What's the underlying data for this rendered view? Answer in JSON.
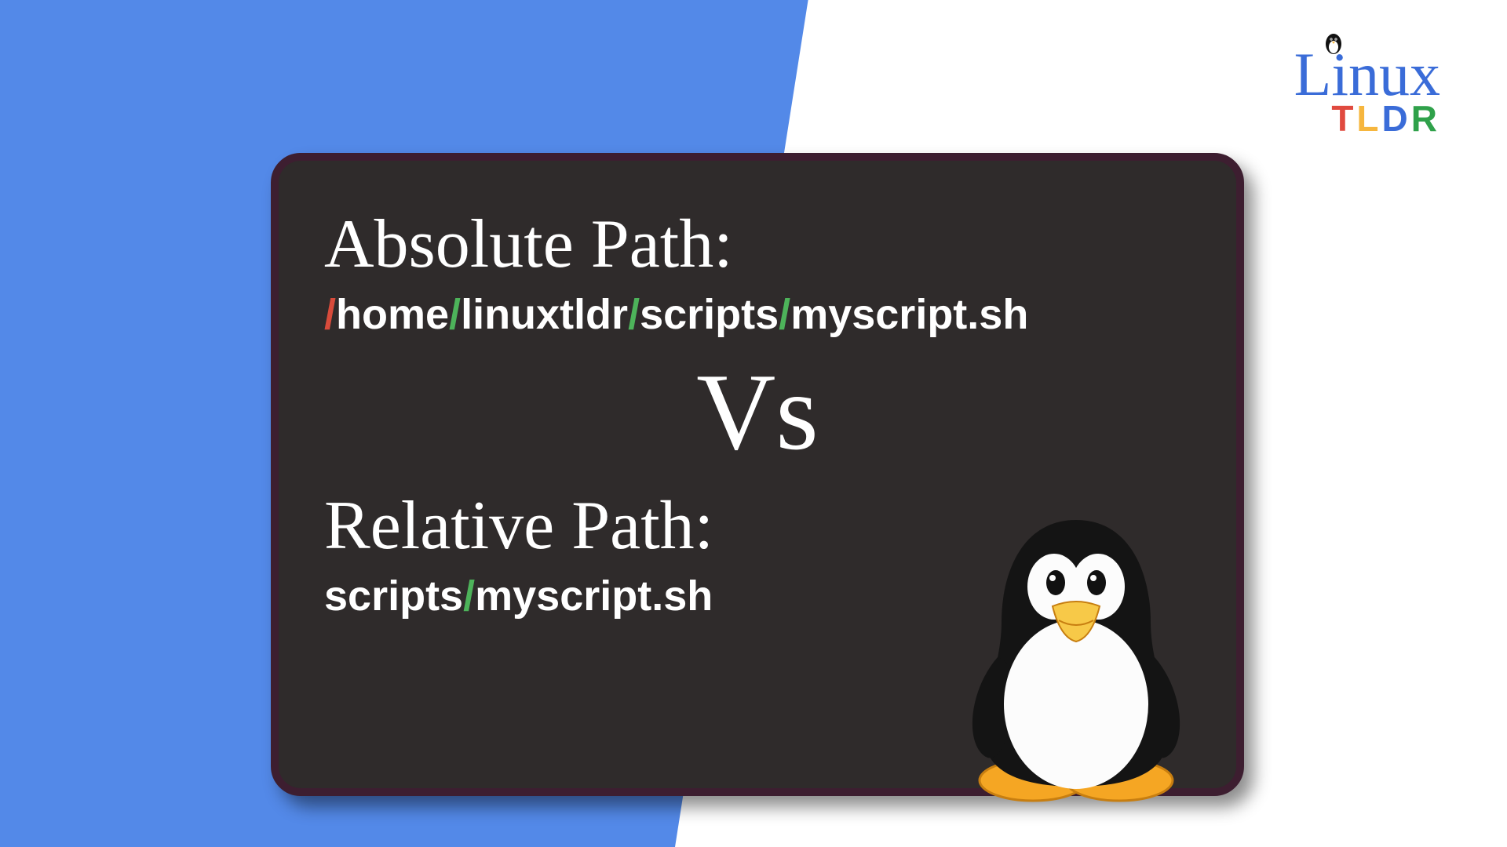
{
  "logo": {
    "text": "Linux",
    "tldr": {
      "t": "T",
      "l": "L",
      "d": "D",
      "r": "R"
    }
  },
  "chalkboard": {
    "absolute_heading": "Absolute Path:",
    "absolute_path": {
      "sep1": "/",
      "seg1": "home",
      "sep2": "/",
      "seg2": "linuxtldr",
      "sep3": "/",
      "seg3": "scripts",
      "sep4": "/",
      "seg4": "myscript.sh"
    },
    "vs": "Vs",
    "relative_heading": "Relative Path:",
    "relative_path": {
      "seg1": "scripts",
      "sep1": "/",
      "seg2": "myscript.sh"
    }
  }
}
